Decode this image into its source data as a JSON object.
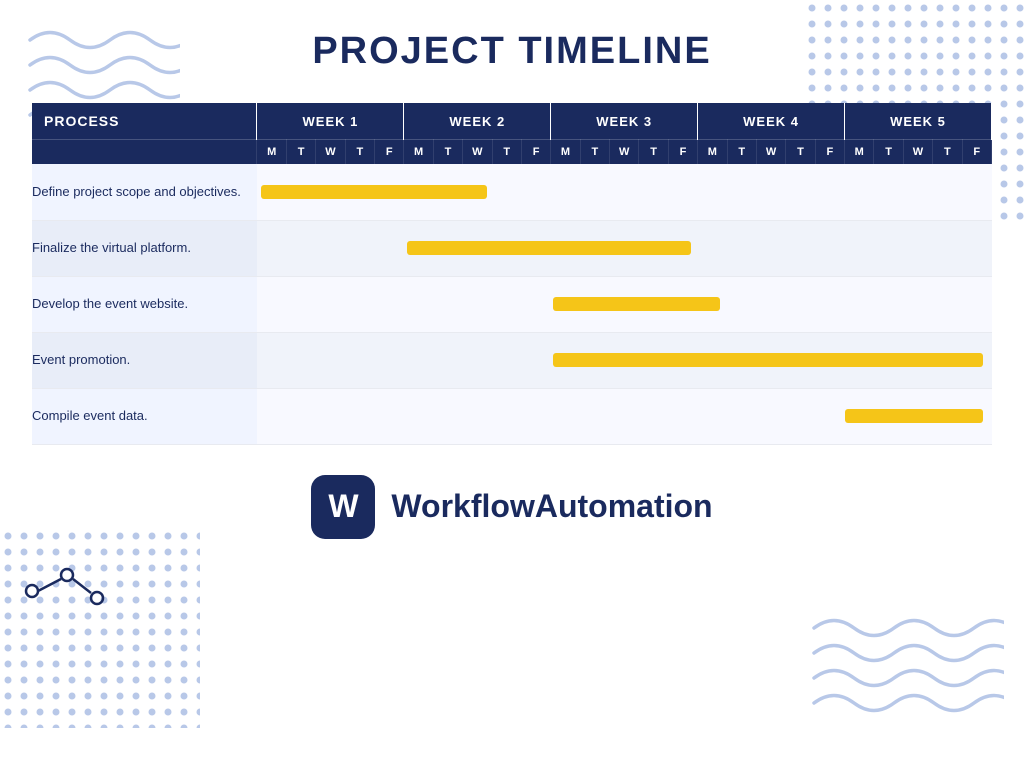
{
  "page": {
    "title": "PROJECT TIMELINE",
    "background_color": "#ffffff"
  },
  "table": {
    "process_header": "PROCESS",
    "weeks": [
      "WEEK 1",
      "WEEK 2",
      "WEEK 3",
      "WEEK 4",
      "WEEK 5"
    ],
    "days": [
      "M",
      "T",
      "W",
      "T",
      "F"
    ],
    "tasks": [
      {
        "label": "Define project scope and objectives.",
        "bar_start_col": 0,
        "bar_span_cols": 8
      },
      {
        "label": "Finalize the virtual platform.",
        "bar_start_col": 5,
        "bar_span_cols": 10
      },
      {
        "label": "Develop the event website.",
        "bar_start_col": 10,
        "bar_span_cols": 6
      },
      {
        "label": "Event promotion.",
        "bar_start_col": 10,
        "bar_span_cols": 15
      },
      {
        "label": "Compile event data.",
        "bar_start_col": 20,
        "bar_span_cols": 5
      }
    ]
  },
  "footer": {
    "brand_name": "WorkflowAutomation",
    "logo_letter": "W"
  },
  "colors": {
    "header_bg": "#1a2a5e",
    "bar_color": "#f5c518",
    "row_odd": "#f0f4ff",
    "row_even": "#e8edf8",
    "title_color": "#1a2a5e"
  }
}
